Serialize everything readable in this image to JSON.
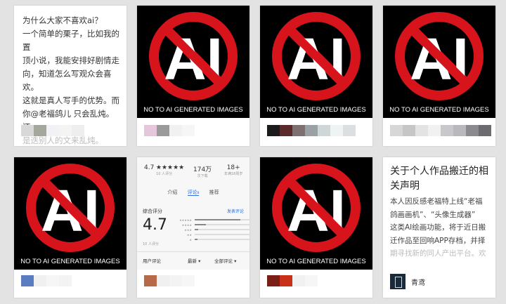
{
  "banner": {
    "caption": "NO TO AI GENERATED IMAGES",
    "letters": "AI",
    "colors": {
      "sign_red": "#d7141b",
      "letter_white": "#ffffff",
      "bg_black": "#000000"
    }
  },
  "cards": [
    {
      "id": "text-post",
      "lines": [
        "为什么大家不喜欢ai？",
        "一个简单的栗子，比如我的置",
        "顶小说，我能安排好剧情走",
        "向，知道怎么写观众会喜欢。",
        "这就是真人写手的优势。而",
        "你@老福鸽儿 只会乱炖。还",
        "是迭别人的文来乱炖。"
      ],
      "swatches": [
        "#d8d8d8",
        "#a3a79c",
        "#f2f2f6",
        "#f4f4f4",
        "#eeeeee"
      ]
    },
    {
      "id": "banner-1",
      "swatches": [
        "#e6c6db",
        "#9a9a9a",
        "#f1f1f1",
        "#f6f6f6"
      ]
    },
    {
      "id": "banner-2",
      "swatches": [
        "#1b1b1b",
        "#5b2a2a",
        "#7e6f71",
        "#9aa1a4",
        "#cfd6d7",
        "#eef4f4",
        "#dcdfe2"
      ]
    },
    {
      "id": "banner-3",
      "swatches": [
        "#d7d7d7",
        "#c6c6c6",
        "#e3e3e3",
        "#f1f1f1",
        "#c8c8cc",
        "#b8b8bd",
        "#8a8a8f",
        "#6b6b70"
      ]
    },
    {
      "id": "banner-4",
      "swatches": [
        "#5a7cc0",
        "#f0f0f0",
        "#f6f6f6",
        "#f3f3f3"
      ]
    },
    {
      "id": "app-card",
      "app": {
        "rating": "4.7",
        "stars": "★★★★★",
        "rating_sub": "10 人评分",
        "downloads": "174万",
        "downloads_sub": "次下载",
        "age": "18+",
        "age_sub": "年满18周岁",
        "tabs": [
          "介绍",
          "评论₈",
          "推荐"
        ],
        "summary_label": "综合评分",
        "post_review": "发表评论",
        "score": "4.7",
        "review_count": "10 人评分",
        "bars": [
          {
            "stars": "★★★★★",
            "fill": 0.72
          },
          {
            "stars": "★★★★",
            "fill": 0.18
          },
          {
            "stars": "★★★",
            "fill": 0.06
          },
          {
            "stars": "★★",
            "fill": 0.0
          },
          {
            "stars": "★",
            "fill": 0.04
          }
        ],
        "footer_left": "用户评论",
        "footer_mid": "最新 ▾",
        "footer_right": "全部评论 ▾"
      },
      "swatches": [
        "#b8694a",
        "#f0f0f0",
        "#f3f3f3",
        "#f6f6f6"
      ]
    },
    {
      "id": "banner-5",
      "swatches": [
        "#7a1f16",
        "#c8301a",
        "#f1f1f1",
        "#f6f6f6"
      ]
    },
    {
      "id": "notice-post",
      "title": "关于个人作品搬迁的相关声明",
      "lines": [
        "本人因反感老福特上线“老福",
        "鸽画画机”、“头像生成器”",
        "这类AI绘画功能，将于近日搬",
        "迁作品至回响APP存档，并择",
        "期寻找新的同人产出平台。欢"
      ],
      "author": "青鸢"
    }
  ]
}
